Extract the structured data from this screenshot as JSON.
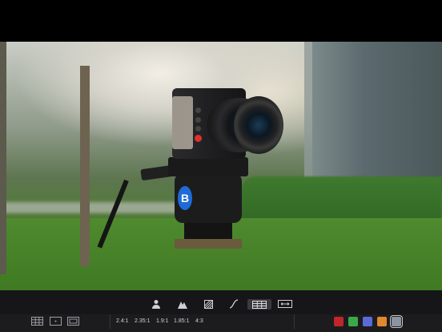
{
  "tools": {
    "person_icon": "person-icon",
    "mountain_icon": "mountain-icon",
    "hatch_icon": "hatch-pattern-icon",
    "curve_icon": "curve-icon",
    "grid_icon": "grid-icon",
    "expand_icon": "horizontal-expand-icon"
  },
  "grid_options": {
    "grid_icon": "grid-3x3-icon",
    "dot_icon": "center-dot-icon",
    "frame_icon": "frame-icon"
  },
  "aspect_ratios": [
    "2.4:1",
    "2.35:1",
    "1.9:1",
    "1.85:1",
    "4:3"
  ],
  "colors": {
    "swatches": [
      {
        "name": "red",
        "hex": "#c0262a"
      },
      {
        "name": "green",
        "hex": "#3ca74a"
      },
      {
        "name": "blue",
        "hex": "#5b6ad8"
      },
      {
        "name": "orange",
        "hex": "#e0882d"
      },
      {
        "name": "gray",
        "hex": "#8a93a0"
      }
    ],
    "selected": "gray"
  }
}
